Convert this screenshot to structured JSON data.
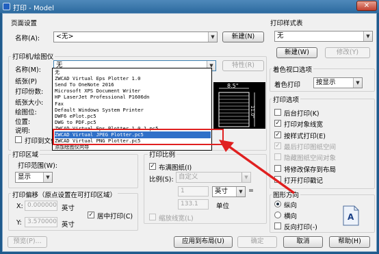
{
  "window": {
    "title": "打印 - Model",
    "close": "✕"
  },
  "page_setup": {
    "group_label": "页面设置",
    "name_label": "名称(A):",
    "name_value": "<无>",
    "new_button": "新建(N)"
  },
  "printer": {
    "group_label": "打印机/绘图仪",
    "name_label": "名称(M):",
    "name_value": "无",
    "properties_button": "特性(R)",
    "plotter_label": "纸张(P)",
    "print_count_label": "打印份数:",
    "paper_size_label": "纸张大小:",
    "plotter_pos_label": "绘图位:",
    "location_label": "位置:",
    "description_label": "说明:",
    "print_to_file_label": "打印到文件",
    "dimension_label": "8.5\"",
    "dimension_label_v": "11.0\"",
    "options": [
      "无",
      "ZWCAD Virtual Eps Plotter 1.0",
      "Send To OneNote 2016",
      "Microsoft XPS Document Writer",
      "HP LaserJet Professional P1606dn",
      "Fax",
      "Default Windows System Printer",
      "DWF6 ePlot.pc5",
      "DWG to PDF.pc5",
      "ZWCAD Virtual Eps Plotter 1.0.1.pc5",
      "ZWCAD Virtual JPEG Plotter.pc5",
      "ZWCAD Virtual PNG Plotter.pc5",
      "添加绘图仪向导"
    ],
    "selected_index": 10
  },
  "print_area": {
    "group_label": "打印区域",
    "range_label": "打印范围(W):",
    "range_value": "显示"
  },
  "print_scale": {
    "group_label": "打印比例",
    "fit_label": "布满图纸(I)",
    "scale_label": "比例(S):",
    "scale_value": "自定义",
    "value1": "1",
    "unit_value": "英寸",
    "value2": "133.1",
    "unit_label": "单位",
    "lineweight_label": "缩放线宽(L)",
    "equals": "="
  },
  "offset": {
    "group_label": "打印偏移（原点设置在可打印区域）",
    "x_label": "X:",
    "x_value": "0.000000",
    "x_unit": "英寸",
    "y_label": "Y:",
    "y_value": "3.570000",
    "y_unit": "英寸",
    "center_label": "居中打印(C)"
  },
  "plot_style": {
    "group_label": "打印样式表",
    "value": "无",
    "new_button": "新建(W)",
    "edit_button": "修改(Y)"
  },
  "shaded": {
    "group_label": "着色视口选项",
    "shade_label": "着色打印",
    "shade_value": "按显示"
  },
  "options": {
    "group_label": "打印选项",
    "items": [
      {
        "label": "后台打印(K)",
        "checked": false,
        "enabled": true
      },
      {
        "label": "打印对象线宽",
        "checked": true,
        "enabled": true
      },
      {
        "label": "按样式打印(E)",
        "checked": true,
        "enabled": true
      },
      {
        "label": "最后打印图纸空间",
        "checked": true,
        "enabled": false
      },
      {
        "label": "隐藏图纸空间对象",
        "checked": false,
        "enabled": false
      },
      {
        "label": "将修改保存到布局",
        "checked": false,
        "enabled": true
      },
      {
        "label": "打开打印戳记",
        "checked": false,
        "enabled": true
      }
    ]
  },
  "orientation": {
    "group_label": "图形方向",
    "portrait": "纵向",
    "landscape": "横向",
    "reverse": "反向打印(-)",
    "page_letter": "A"
  },
  "footer": {
    "preview": "预览(P)...",
    "apply": "应用到布局(U)",
    "ok": "确定",
    "cancel": "取消",
    "help": "帮助(H)"
  },
  "colors": {
    "accent": "#3070c8",
    "highlight_red": "#e02020",
    "title_bar": "#2c6a9f"
  }
}
